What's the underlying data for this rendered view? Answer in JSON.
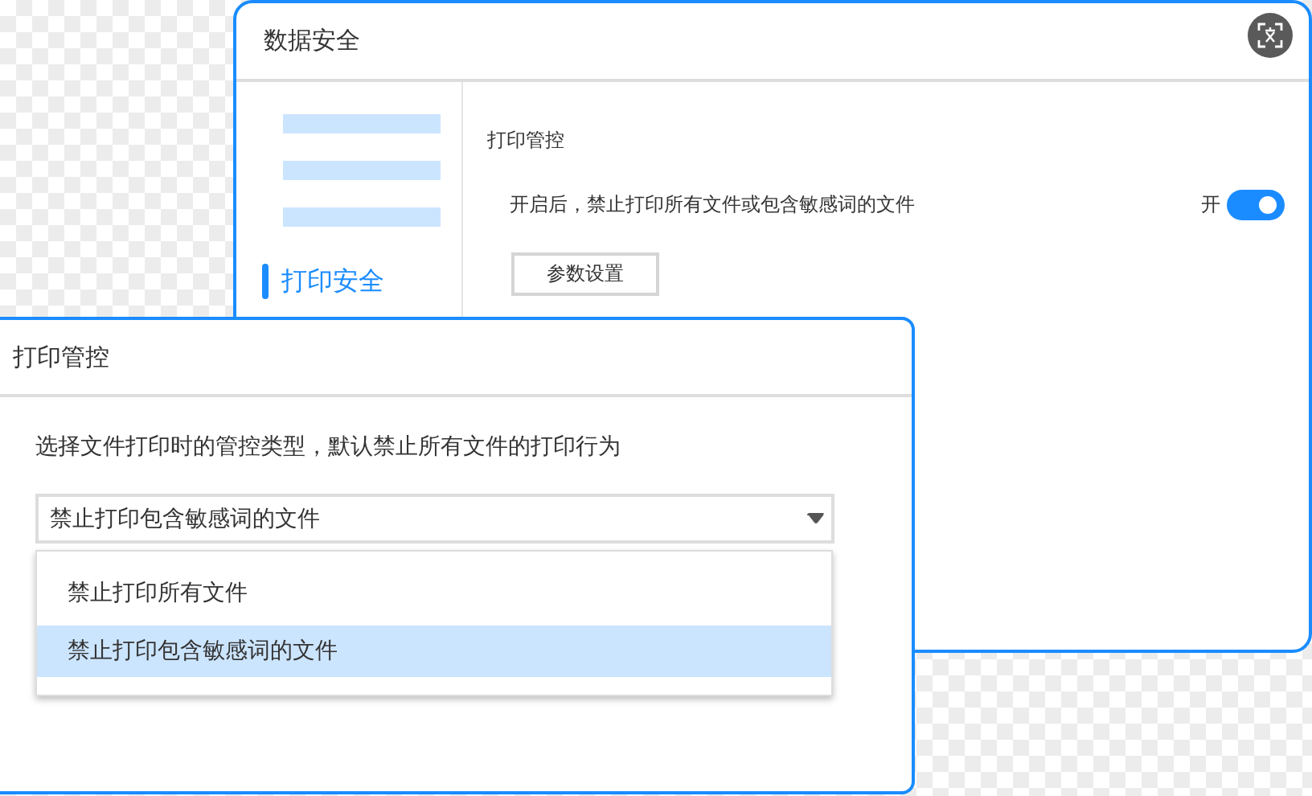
{
  "settings_window": {
    "title": "数据安全",
    "sidebar": {
      "items": [
        {
          "label": "打印安全",
          "selected": true
        }
      ]
    },
    "section": {
      "title": "打印管控",
      "description": "开启后，禁止打印所有文件或包含敏感词的文件",
      "toggle": {
        "label": "开",
        "on": true
      },
      "button": "参数设置"
    }
  },
  "dialog": {
    "title": "打印管控",
    "description": "选择文件打印时的管控类型，默认禁止所有文件的打印行为",
    "select": {
      "value": "禁止打印包含敏感词的文件",
      "expanded": true
    },
    "options": [
      {
        "label": "禁止打印所有文件",
        "selected": false
      },
      {
        "label": "禁止打印包含敏感词的文件",
        "selected": true
      }
    ]
  }
}
